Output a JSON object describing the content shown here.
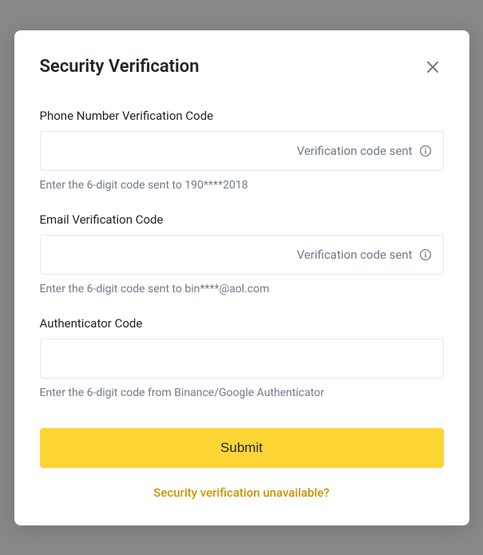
{
  "modal": {
    "title": "Security Verification",
    "phone": {
      "label": "Phone Number Verification Code",
      "sent_text": "Verification code sent",
      "help": "Enter the 6-digit code sent to 190****2018"
    },
    "email": {
      "label": "Email Verification Code",
      "sent_text": "Verification code sent",
      "help": "Enter the 6-digit code sent to bin****@aol.com"
    },
    "authenticator": {
      "label": "Authenticator Code",
      "help": "Enter the 6-digit code from Binance/Google Authenticator"
    },
    "submit_label": "Submit",
    "unavailable_label": "Security verification unavailable?"
  }
}
